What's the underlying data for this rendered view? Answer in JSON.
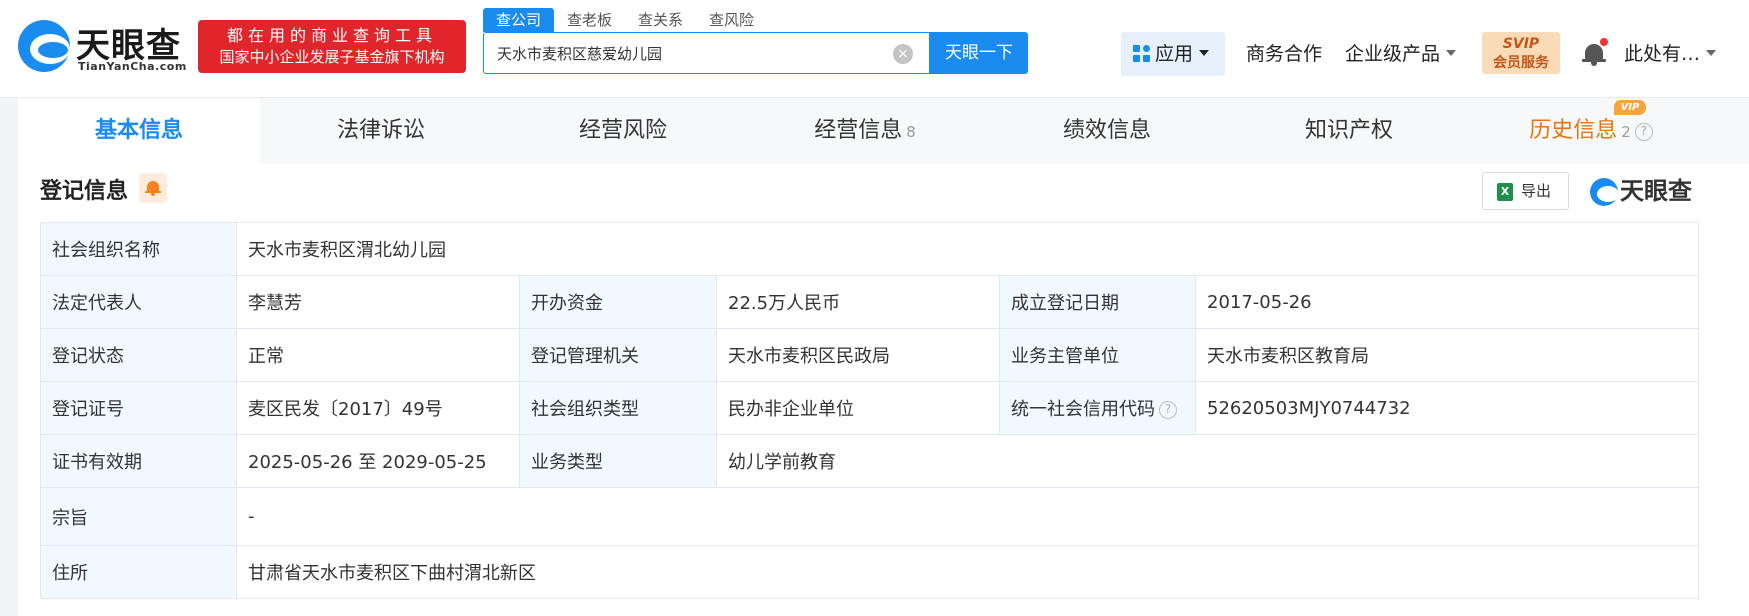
{
  "header": {
    "brand_name": "天眼查",
    "brand_domain": "TianYanCha.com",
    "promo_line1": "都在用的商业查询工具",
    "promo_line2": "国家中小企业发展子基金旗下机构",
    "search_tabs": [
      "查公司",
      "查老板",
      "查关系",
      "查风险"
    ],
    "search_value": "天水市麦积区慈爱幼儿园",
    "search_button": "天眼一下",
    "nav": {
      "app": "应用",
      "business": "商务合作",
      "enterprise": "企业级产品",
      "svip_top": "SVIP",
      "svip_bottom": "会员服务",
      "user": "此处有…"
    }
  },
  "tabs": [
    {
      "label": "基本信息",
      "count": ""
    },
    {
      "label": "法律诉讼",
      "count": ""
    },
    {
      "label": "经营风险",
      "count": ""
    },
    {
      "label": "经营信息",
      "count": "8"
    },
    {
      "label": "绩效信息",
      "count": ""
    },
    {
      "label": "知识产权",
      "count": ""
    },
    {
      "label": "历史信息",
      "count": "2"
    }
  ],
  "vip_tag": "VIP",
  "section": {
    "title": "登记信息",
    "export_label": "导出",
    "brand": "天眼查"
  },
  "info": {
    "org_name_label": "社会组织名称",
    "org_name": "天水市麦积区渭北幼儿园",
    "legal_rep_label": "法定代表人",
    "legal_rep": "李慧芳",
    "funds_label": "开办资金",
    "funds": "22.5万人民币",
    "reg_date_label": "成立登记日期",
    "reg_date": "2017-05-26",
    "status_label": "登记状态",
    "status": "正常",
    "authority_label": "登记管理机关",
    "authority": "天水市麦积区民政局",
    "supervisor_label": "业务主管单位",
    "supervisor": "天水市麦积区教育局",
    "cert_no_label": "登记证号",
    "cert_no": "麦区民发〔2017〕49号",
    "org_type_label": "社会组织类型",
    "org_type": "民办非企业单位",
    "credit_code_label": "统一社会信用代码",
    "credit_code": "52620503MJY0744732",
    "validity_label": "证书有效期",
    "validity": "2025-05-26 至 2029-05-25",
    "biz_type_label": "业务类型",
    "biz_type": "幼儿学前教育",
    "purpose_label": "宗旨",
    "purpose": "-",
    "address_label": "住所",
    "address": "甘肃省天水市麦积区下曲村渭北新区"
  }
}
